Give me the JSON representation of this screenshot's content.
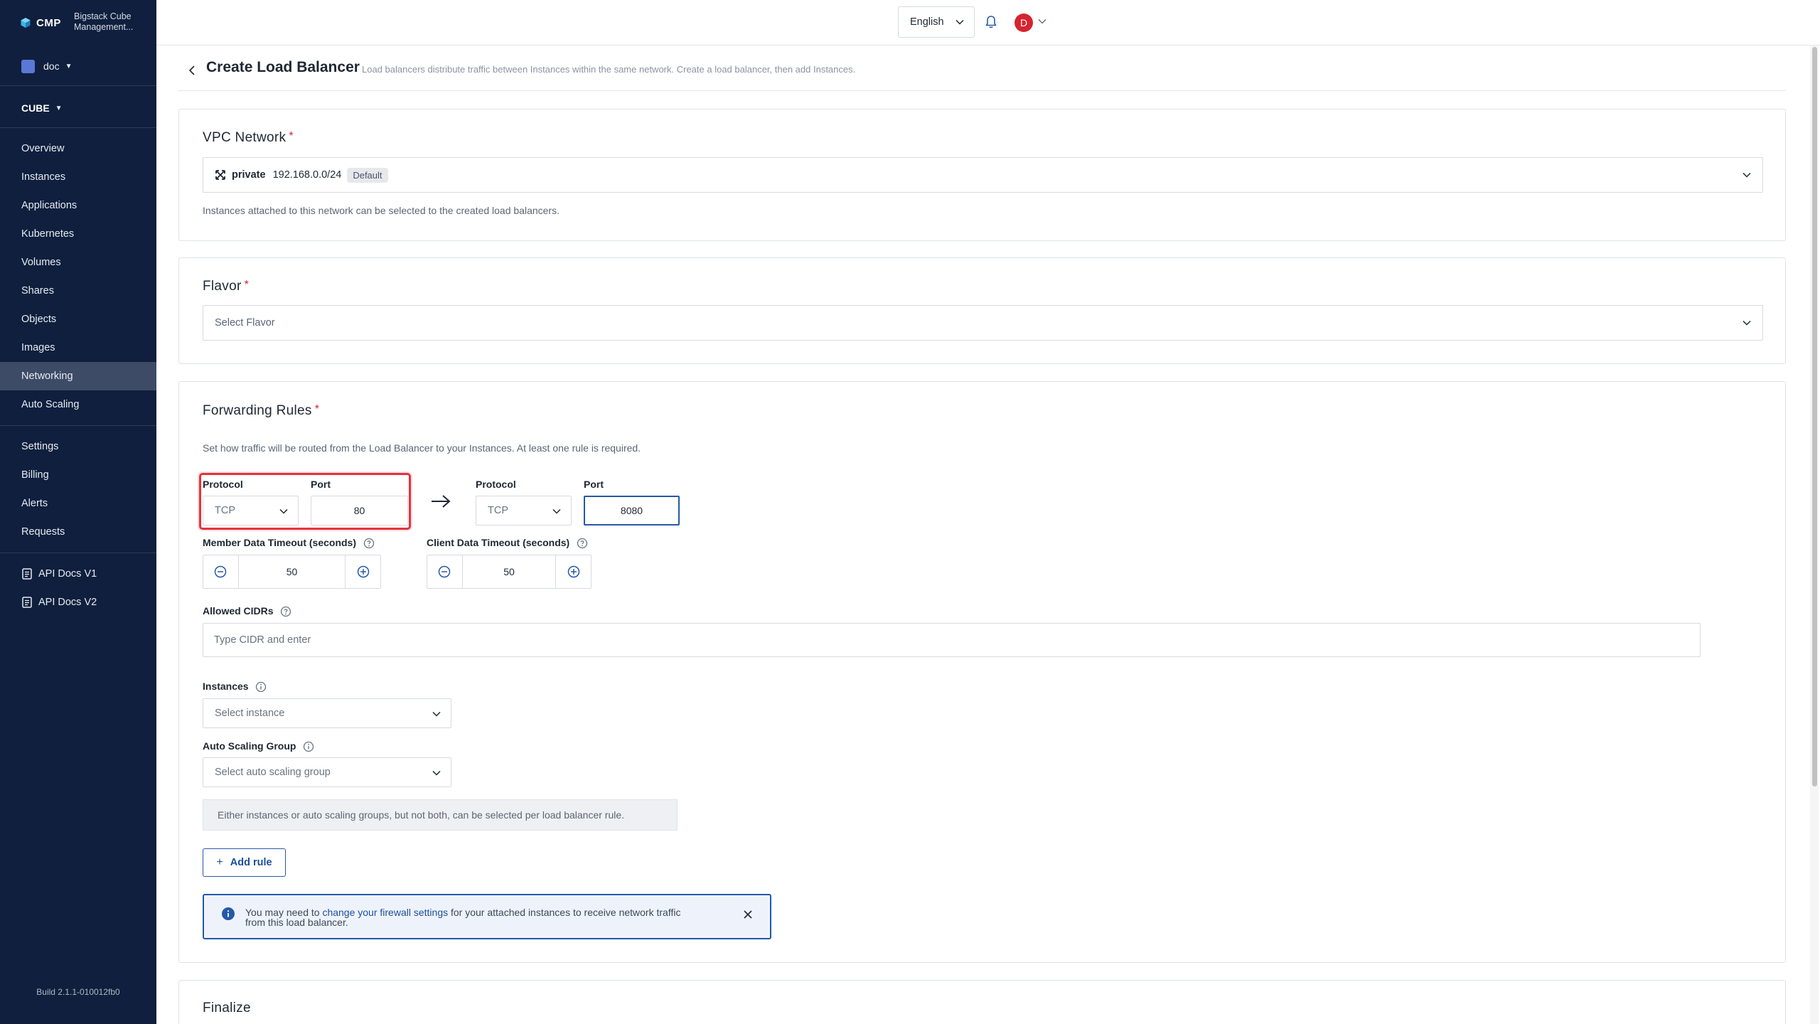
{
  "brand": {
    "logo_text": "CMP",
    "name": "Bigstack Cube Management..."
  },
  "org": {
    "name": "doc"
  },
  "project": {
    "name": "CUBE"
  },
  "nav": {
    "main": [
      "Overview",
      "Instances",
      "Applications",
      "Kubernetes",
      "Volumes",
      "Shares",
      "Objects",
      "Images",
      "Networking",
      "Auto Scaling"
    ],
    "active": "Networking",
    "secondary": [
      "Settings",
      "Billing",
      "Alerts",
      "Requests"
    ],
    "docs": [
      "API Docs V1",
      "API Docs V2"
    ]
  },
  "build": "Build 2.1.1-010012fb0",
  "topbar": {
    "language": "English",
    "avatar_initial": "D"
  },
  "page": {
    "title": "Create Load Balancer",
    "subtitle": "Load balancers distribute traffic between Instances within the same network. Create a load balancer, then add Instances."
  },
  "vpc": {
    "title": "VPC Network",
    "required_mark": "*",
    "network_name": "private",
    "network_cidr": "192.168.0.0/24",
    "badge": "Default",
    "help": "Instances attached to this network can be selected to the created load balancers."
  },
  "flavor": {
    "title": "Flavor",
    "required_mark": "*",
    "placeholder": "Select Flavor"
  },
  "forwarding": {
    "title": "Forwarding Rules",
    "required_mark": "*",
    "help": "Set how traffic will be routed from the Load Balancer to your Instances. At least one rule is required.",
    "source": {
      "protocol_label": "Protocol",
      "protocol_value": "TCP",
      "port_label": "Port",
      "port_value": "80"
    },
    "target": {
      "protocol_label": "Protocol",
      "protocol_value": "TCP",
      "port_label": "Port",
      "port_value": "8080"
    },
    "member_timeout": {
      "label": "Member Data Timeout (seconds)",
      "value": "50"
    },
    "client_timeout": {
      "label": "Client Data Timeout (seconds)",
      "value": "50"
    },
    "allowed_cidrs": {
      "label": "Allowed CIDRs",
      "placeholder": "Type CIDR and enter"
    },
    "instances": {
      "label": "Instances",
      "placeholder": "Select instance"
    },
    "asg": {
      "label": "Auto Scaling Group",
      "placeholder": "Select auto scaling group"
    },
    "notice": "Either instances or auto scaling groups, but not both, can be selected per load balancer rule.",
    "add_rule": "Add rule",
    "info": {
      "prefix": "You may need to ",
      "link": "change your firewall settings",
      "suffix": " for your attached instances to receive network traffic from this load balancer."
    }
  },
  "finalize": {
    "title": "Finalize"
  },
  "colors": {
    "sidebar": "#0f1f3d",
    "accent": "#1d4f9b",
    "highlight": "#e5323b",
    "required": "#d52430"
  }
}
